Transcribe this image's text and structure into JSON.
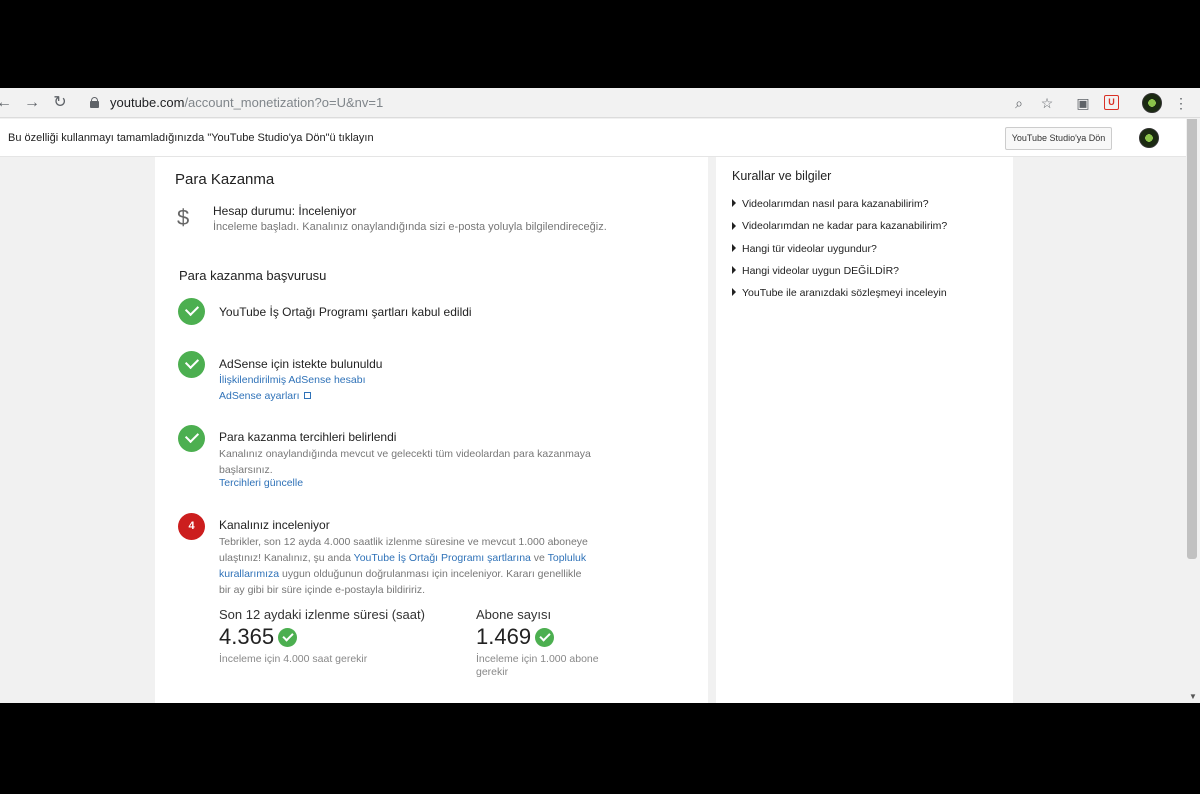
{
  "browser": {
    "url_host": "youtube.com",
    "url_path": "/account_monetization?o=U&nv=1"
  },
  "infobar": {
    "text": "Bu özelliği kullanmayı tamamladığınızda \"YouTube Studio'ya Dön\"ü tıklayın",
    "button": "YouTube Studio'ya Dön"
  },
  "main": {
    "title": "Para Kazanma",
    "status_title": "Hesap durumu: İnceleniyor",
    "status_sub": "İnceleme başladı. Kanalınız onaylandığında sizi e-posta yoluyla bilgilendireceğiz.",
    "section_title": "Para kazanma başvurusu",
    "steps": [
      {
        "title": "YouTube İş Ortağı Programı şartları kabul edildi"
      },
      {
        "title": "AdSense için istekte bulunuldu",
        "link1": "İlişkilendirilmiş AdSense hesabı",
        "link2": "AdSense ayarları"
      },
      {
        "title": "Para kazanma tercihleri belirlendi",
        "text": "Kanalınız onaylandığında mevcut ve gelecekti tüm videolardan para kazanmaya başlarsınız.",
        "link": "Tercihleri güncelle"
      },
      {
        "badge": "4",
        "title": "Kanalınız inceleniyor",
        "text_a": "Tebrikler, son 12 ayda 4.000 saatlik izlenme süresine ve mevcut 1.000 aboneye ulaştınız! Kanalınız, şu anda ",
        "link_a": "YouTube İş Ortağı Programı şartlarına",
        "text_b": " ve ",
        "link_b": "Topluluk kurallarımıza",
        "text_c": " uygun olduğunun doğrulanması için inceleniyor. Kararı genellikle bir ay gibi bir süre içinde e-postayla bildiririz."
      }
    ],
    "metrics": [
      {
        "label": "Son 12 aydaki izlenme süresi (saat)",
        "value": "4.365",
        "note": "İnceleme için 4.000 saat gerekir"
      },
      {
        "label": "Abone sayısı",
        "value": "1.469",
        "note": "İnceleme için 1.000 abone gerekir"
      }
    ]
  },
  "side": {
    "title": "Kurallar ve bilgiler",
    "items": [
      "Videolarımdan nasıl para kazanabilirim?",
      "Videolarımdan ne kadar para kazanabilirim?",
      "Hangi tür videolar uygundur?",
      "Hangi videolar uygun DEĞİLDİR?",
      "YouTube ile aranızdaki sözleşmeyi inceleyin"
    ]
  },
  "colors": {
    "accent_green": "#4caf50",
    "link_blue": "#2f72b8",
    "badge_red": "#cc1e1e"
  },
  "icons": [
    "back-arrow-icon",
    "forward-arrow-icon",
    "reload-icon",
    "lock-icon",
    "zoom-icon",
    "star-icon",
    "extension-icon",
    "shield-icon",
    "menu-icon",
    "dollar-icon",
    "check-icon",
    "external-link-icon",
    "triangle-icon"
  ]
}
